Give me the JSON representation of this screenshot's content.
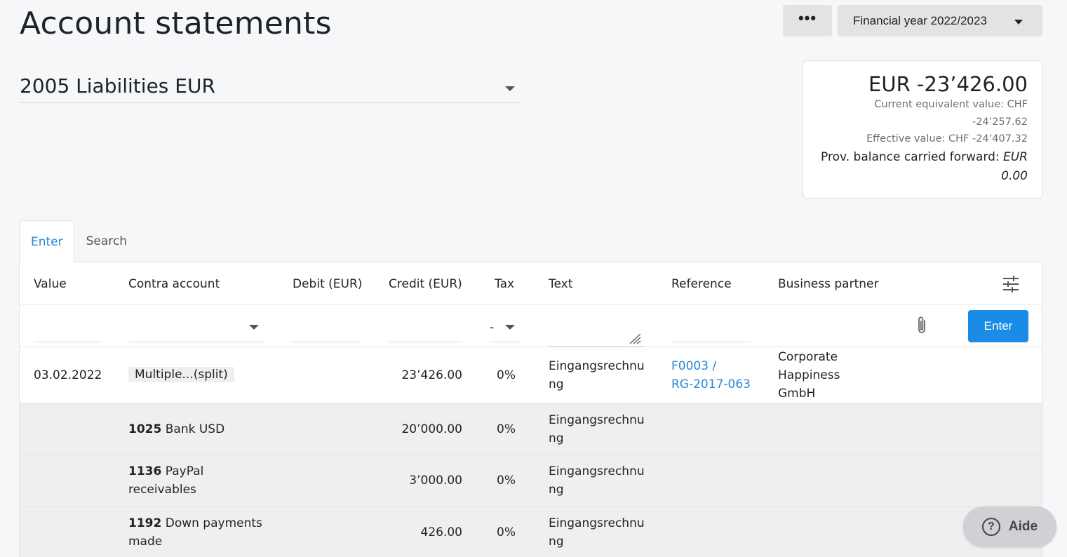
{
  "header": {
    "title": "Account statements",
    "more_label": "•••",
    "financial_year": "Financial year 2022/2023"
  },
  "account": {
    "selected": "2005 Liabilities EUR"
  },
  "balance": {
    "main": "EUR -23’426.00",
    "current_equivalent_line1": "Current equivalent value: CHF",
    "current_equivalent_line2": "-24’257.62",
    "effective": "Effective value: CHF -24’407.32",
    "prov_label": "Prov. balance carried forward:",
    "prov_value_1": "EUR",
    "prov_value_2": "0.00"
  },
  "tabs": [
    {
      "label": "Enter",
      "active": true
    },
    {
      "label": "Search",
      "active": false
    }
  ],
  "columns": {
    "value": "Value",
    "contra": "Contra account",
    "debit": "Debit (EUR)",
    "credit": "Credit (EUR)",
    "tax": "Tax",
    "text": "Text",
    "reference": "Reference",
    "partner": "Business partner"
  },
  "entry": {
    "tax_default": "-",
    "enter_label": "Enter"
  },
  "rows": [
    {
      "value": "03.02.2022",
      "contra": "Multiple...(split)",
      "credit": "23’426.00",
      "tax": "0%",
      "text_1": "Eingangsrechnu",
      "text_2": "ng",
      "reference_1": "F0003 /",
      "reference_2": "RG-2017-063",
      "partner_1": "Corporate",
      "partner_2": "Happiness",
      "partner_3": "GmbH"
    },
    {
      "contra_code": "1025",
      "contra_name_1": "Bank USD",
      "credit": "20’000.00",
      "tax": "0%",
      "text_1": "Eingangsrechnu",
      "text_2": "ng"
    },
    {
      "contra_code": "1136",
      "contra_name_1": "PayPal",
      "contra_name_2": "receivables",
      "credit": "3’000.00",
      "tax": "0%",
      "text_1": "Eingangsrechnu",
      "text_2": "ng"
    },
    {
      "contra_code": "1192",
      "contra_name_1": "Down payments",
      "contra_name_2": "made",
      "credit": "426.00",
      "tax": "0%",
      "text_1": "Eingangsrechnu",
      "text_2": "ng"
    }
  ],
  "help": {
    "label": "Aide",
    "icon_glyph": "?"
  }
}
